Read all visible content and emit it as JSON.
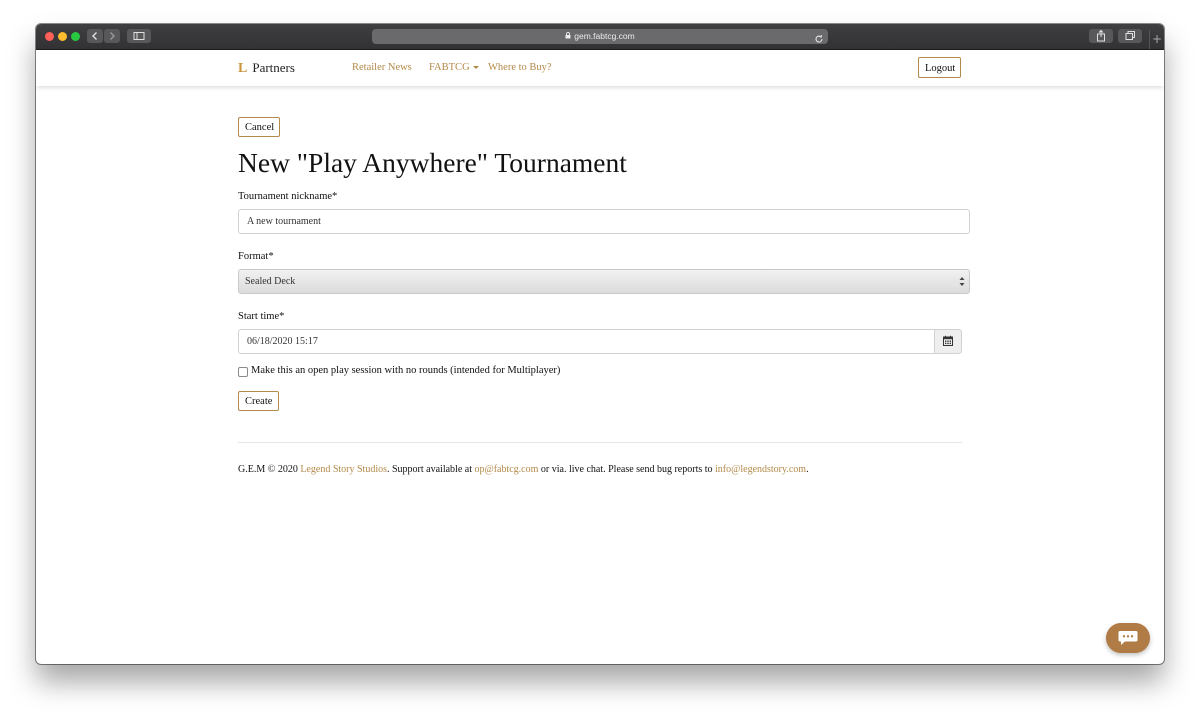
{
  "browser": {
    "url": "gem.fabtcg.com",
    "back_icon": "chevron-left-icon",
    "forward_icon": "chevron-right-icon",
    "sidebar_icon": "sidebar-icon",
    "reload_icon": "reload-icon",
    "share_icon": "share-icon",
    "tabs_icon": "tabs-icon",
    "new_tab_label": "+"
  },
  "navbar": {
    "brand_logo": "L",
    "brand_label": "Partners",
    "links": [
      {
        "label": "Retailer News"
      },
      {
        "label": "FABTCG"
      },
      {
        "label": "Where to Buy?"
      }
    ],
    "logout_label": "Logout"
  },
  "page": {
    "cancel_label": "Cancel",
    "title": "New \"Play Anywhere\" Tournament"
  },
  "form": {
    "nickname_label": "Tournament nickname*",
    "nickname_value": "A new tournament",
    "format_label": "Format*",
    "format_value": "Sealed Deck",
    "start_label": "Start time*",
    "start_value": "06/18/2020 15:17",
    "open_play_label": "Make this an open play session with no rounds (intended for Multiplayer)",
    "open_play_checked": false,
    "create_label": "Create"
  },
  "footer": {
    "prefix": "G.E.M © 2020 ",
    "studio_link": "Legend Story Studios",
    "support_text": ". Support available at ",
    "support_email": "op@fabtcg.com",
    "middle_text": " or via. live chat. Please send bug reports to ",
    "bug_email": "info@legendstory.com",
    "suffix": "."
  },
  "colors": {
    "accent": "#b48a4a",
    "chat_button": "#b07b45",
    "logo": "#c9953a"
  }
}
